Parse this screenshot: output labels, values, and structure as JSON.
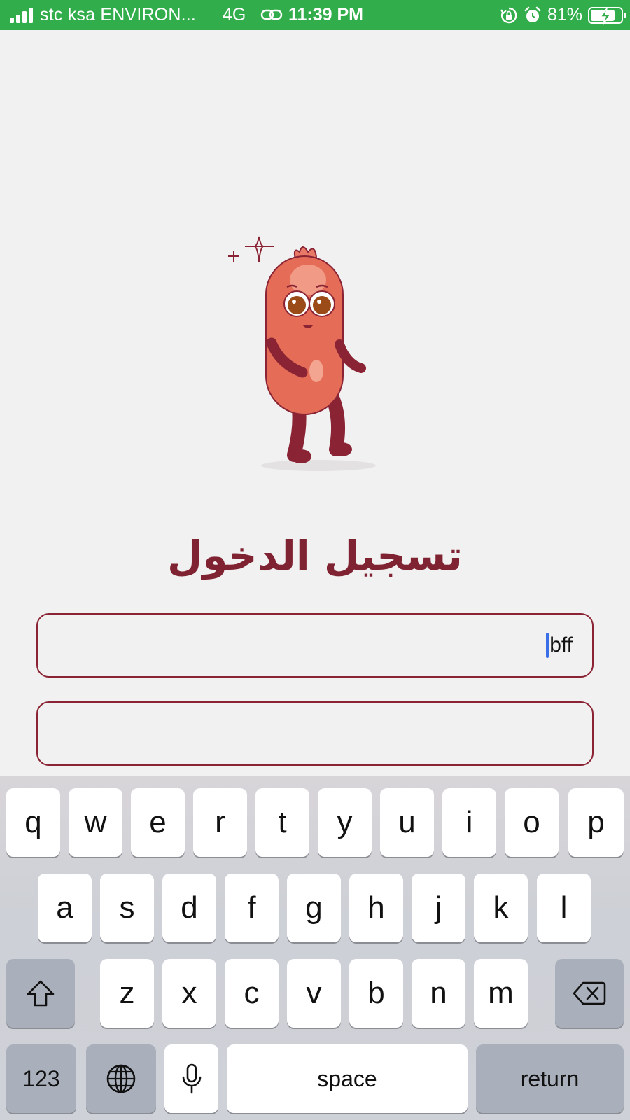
{
  "status_bar": {
    "carrier": "stc ksa ENVIRON...",
    "network": "4G",
    "time": "11:39 PM",
    "battery_percent": "81%",
    "battery_level": 0.81,
    "icons": [
      "signal-icon",
      "link-icon",
      "rotation-lock-icon",
      "alarm-icon",
      "battery-charging-icon"
    ],
    "color": "#32ad4c"
  },
  "login": {
    "title": "تسجيل الدخول",
    "username_value": "bff",
    "password_value": "",
    "accent_color": "#8a2435"
  },
  "keyboard": {
    "row1": [
      "q",
      "w",
      "e",
      "r",
      "t",
      "y",
      "u",
      "i",
      "o",
      "p"
    ],
    "row2": [
      "a",
      "s",
      "d",
      "f",
      "g",
      "h",
      "j",
      "k",
      "l"
    ],
    "row3": [
      "z",
      "x",
      "c",
      "v",
      "b",
      "n",
      "m"
    ],
    "numbers_label": "123",
    "space_label": "space",
    "return_label": "return",
    "icons": [
      "shift-icon",
      "backspace-icon",
      "globe-icon",
      "microphone-icon"
    ]
  }
}
